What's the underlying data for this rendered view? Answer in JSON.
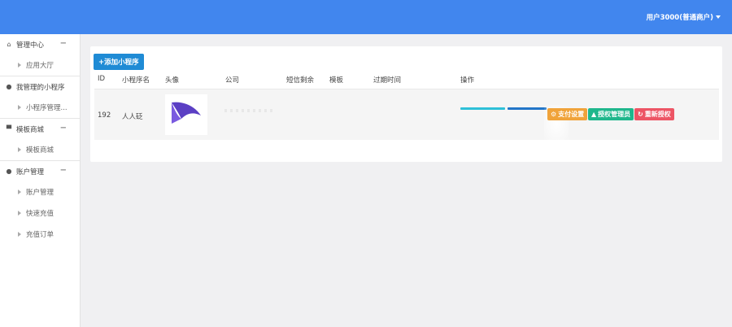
{
  "header": {
    "user_label": "用户3000(普通商户)",
    "caret_icon": "caret-down-icon",
    "bg_color": "#4186ee"
  },
  "sidebar": {
    "groups": [
      {
        "icon": "home-icon",
        "title": "管理中心",
        "toggle": "−",
        "items": [
          "应用大厅"
        ]
      },
      {
        "icon": "chat-icon",
        "title": "我管理的小程序",
        "toggle": "",
        "items": [
          "小程序管理..."
        ]
      },
      {
        "icon": "cart-icon",
        "title": "模板商城",
        "toggle": "−",
        "items": [
          "模板商城"
        ]
      },
      {
        "icon": "user-icon",
        "title": "账户管理",
        "toggle": "−",
        "items": [
          "账户管理",
          "快速充值",
          "充值订单"
        ]
      }
    ]
  },
  "toolbar": {
    "add_label": "+添加小程序",
    "add_color": "#1f8bd5"
  },
  "table": {
    "headers": [
      "ID",
      "小程序名",
      "头像",
      "公司",
      "短信剩余",
      "模板",
      "过期时间",
      "操作"
    ],
    "rows": [
      {
        "id": "192",
        "name": "人人砭",
        "avatar_icon": "logo-avatar-icon"
      }
    ]
  },
  "actions": [
    {
      "label": "支付设置",
      "icon": "gear-icon",
      "color": "#f0a33a"
    },
    {
      "label": "授权管理员",
      "icon": "user-icon",
      "color": "#1fb78c"
    },
    {
      "label": "重新授权",
      "icon": "refresh-icon",
      "color": "#ed5565"
    }
  ],
  "colors": {
    "cyan": "#2ec0d8",
    "blue": "#2376c8"
  }
}
